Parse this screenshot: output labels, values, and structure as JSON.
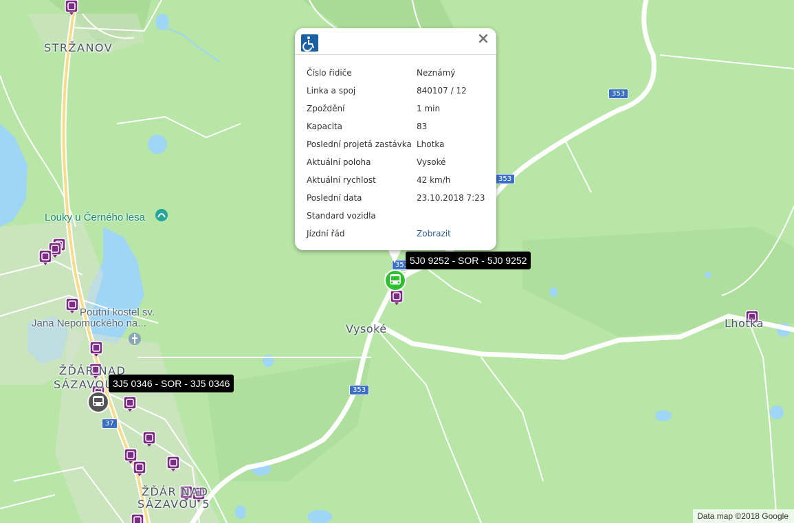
{
  "map": {
    "place_labels": [
      {
        "id": "strzanov",
        "text": "STRŽANOV"
      },
      {
        "id": "zdar-line1",
        "text": "ŽĎÁR NAD"
      },
      {
        "id": "zdar-line2",
        "text": "SÁZAVOU"
      },
      {
        "id": "zdar5-line1",
        "text": "ŽĎÁR NAD"
      },
      {
        "id": "zdar5-line2",
        "text": "SÁZAVOU 5"
      },
      {
        "id": "vysoke",
        "text": "Vysoké"
      },
      {
        "id": "lhotka",
        "text": "Lhotka"
      }
    ],
    "poi_labels": {
      "louky": "Louky u Černého lesa",
      "kostel_line1": "Poutní kostel sv.",
      "kostel_line2": "Jana Nepomuckého na..."
    },
    "road_badges": [
      "353",
      "353",
      "353",
      "37",
      "353"
    ],
    "attribution": "Data map ©2018 Google"
  },
  "vehicles": [
    {
      "label": "5J0 9252 - SOR - 5J0 9252",
      "status": "active",
      "color": "#2ec02e"
    },
    {
      "label": "3J5 0346 - SOR - 3J5 0346",
      "status": "inactive",
      "color": "#555555"
    }
  ],
  "popup": {
    "header_icon": "wheelchair-icon",
    "close_label": "×",
    "rows": [
      {
        "label": "Číslo řidiče",
        "value": "Neznámý"
      },
      {
        "label": "Linka a spoj",
        "value": "840107 / 12"
      },
      {
        "label": "Zpoždění",
        "value": "1 min"
      },
      {
        "label": "Kapacita",
        "value": "83"
      },
      {
        "label": "Poslední projetá zastávka",
        "value": "Lhotka"
      },
      {
        "label": "Aktuální poloha",
        "value": "Vysoké"
      },
      {
        "label": "Aktuální rychlost",
        "value": "42 km/h"
      },
      {
        "label": "Poslední data",
        "value": "23.10.2018 7:23"
      },
      {
        "label": "Standard vozidla",
        "value": ""
      },
      {
        "label": "Jízdní řád",
        "value": "Zobrazit"
      }
    ]
  },
  "colors": {
    "map_land": "#b8e6a6",
    "map_dark_green": "#a6dd93",
    "water": "#9fd5f5",
    "road_major": "#ffffff",
    "road_primary": "#f7dc8e",
    "town": "#dde5d6",
    "stop_marker": "#7a2d82",
    "road_badge": "#3b6fc4"
  }
}
